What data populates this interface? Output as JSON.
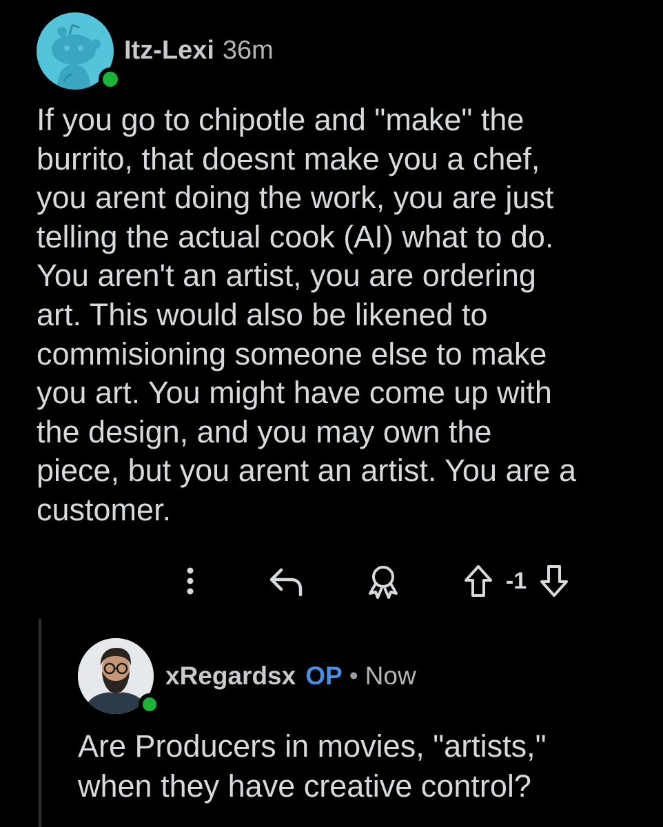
{
  "comment": {
    "username": "Itz-Lexi",
    "timestamp": "36m",
    "body": "If you go to chipotle and \"make\" the\nburrito, that doesnt make you a chef,\nyou arent doing the work, you are just\ntelling the actual cook (AI) what to do.\nYou aren't an artist, you are ordering\nart. This would also be likened to\ncommisioning someone else to make\nyou art. You might have come up with\nthe design, and you may own the\npiece, but you arent an artist. You are a\ncustomer.",
    "avatar_icon": "snoo-avatar-icon",
    "online_status_color": "#1db33a"
  },
  "actions": {
    "more_icon": "more-vertical-icon",
    "reply_icon": "reply-icon",
    "award_icon": "award-icon",
    "upvote_icon": "upvote-icon",
    "score": "-1",
    "downvote_icon": "downvote-icon"
  },
  "reply": {
    "username": "xRegardsx",
    "op_badge": "OP",
    "separator": "•",
    "timestamp": "Now",
    "body": "Are Producers in movies, \"artists,\"\nwhen they have creative control?",
    "avatar_icon": "user-photo-avatar",
    "op_color": "#4a8fe6"
  },
  "colors": {
    "background": "#000000",
    "text": "#d7dadc",
    "thread_line": "#2f3133"
  }
}
